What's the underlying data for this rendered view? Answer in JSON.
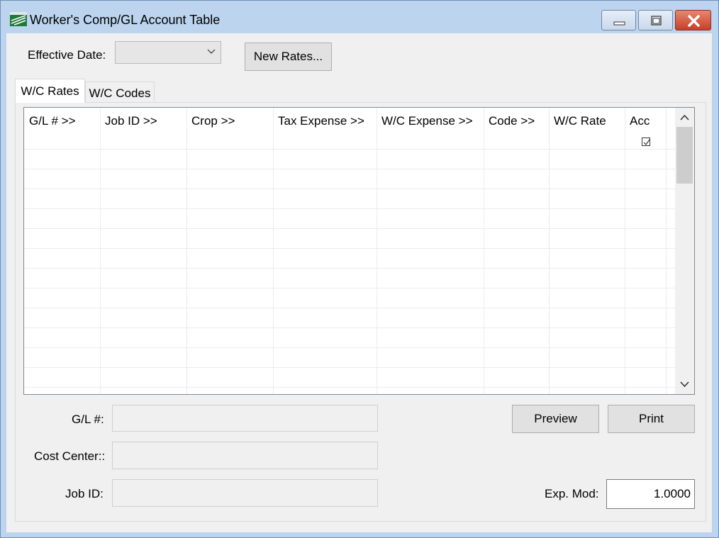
{
  "window": {
    "title": "Worker's Comp/GL Account Table",
    "app_icon": "green-field-app-icon",
    "controls": [
      "minimize-icon",
      "maximize-icon",
      "close-icon"
    ]
  },
  "toolbar": {
    "effective_date_label": "Effective Date:",
    "effective_date_value": "",
    "new_rates_label": "New Rates..."
  },
  "tabs": [
    {
      "label": "W/C Rates",
      "active": true
    },
    {
      "label": "W/C Codes",
      "active": false
    }
  ],
  "grid": {
    "columns": [
      "G/L # >>",
      "Job ID >>",
      "Crop >>",
      "Tax Expense >>",
      "W/C Expense >>",
      "Code >>",
      "W/C Rate",
      "Acc"
    ],
    "acc_header_checked": true,
    "rows": []
  },
  "form": {
    "gl_label": "G/L #:",
    "gl_value": "",
    "cost_center_label": "Cost Center::",
    "cost_center_value": "",
    "job_id_label": "Job ID:",
    "job_id_value": "",
    "exp_mod_label": "Exp. Mod:",
    "exp_mod_value": "1.0000"
  },
  "actions": {
    "preview_label": "Preview",
    "print_label": "Print"
  },
  "colors": {
    "titlebar": "#bcd4ee",
    "close_button": "#c6402b",
    "client_background": "#f0f0f0"
  }
}
